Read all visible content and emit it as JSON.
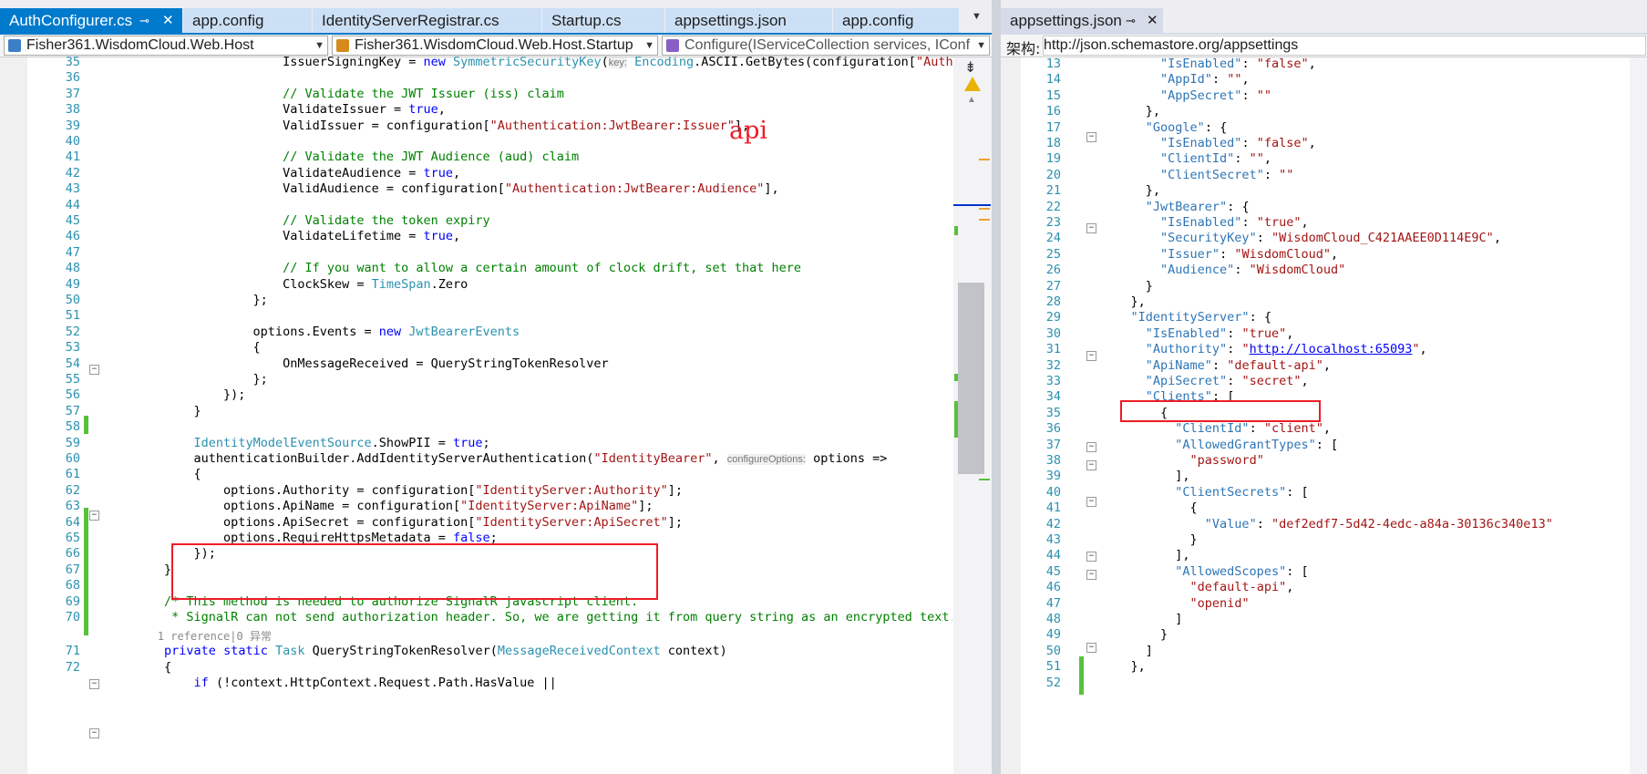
{
  "left_pane": {
    "tabs": [
      {
        "label": "AuthConfigurer.cs",
        "state": "active-pinned"
      },
      {
        "label": "app.config",
        "state": "inactive"
      },
      {
        "label": "IdentityServerRegistrar.cs",
        "state": "inactive"
      },
      {
        "label": "Startup.cs",
        "state": "inactive"
      },
      {
        "label": "appsettings.json",
        "state": "inactive"
      },
      {
        "label": "app.config",
        "state": "inactive"
      }
    ],
    "nav": {
      "project": "Fisher361.WisdomCloud.Web.Host",
      "class": "Fisher361.WisdomCloud.Web.Host.Startup",
      "member": "Configure(IServiceCollection services, IConf"
    },
    "annotation": "api",
    "line_numbers": [
      "35",
      "36",
      "37",
      "38",
      "39",
      "40",
      "41",
      "42",
      "43",
      "44",
      "45",
      "46",
      "47",
      "48",
      "49",
      "50",
      "51",
      "52",
      "53",
      "54",
      "55",
      "56",
      "57",
      "58",
      "59",
      "60",
      "61",
      "62",
      "63",
      "64",
      "65",
      "66",
      "67",
      "68",
      "69",
      "70",
      "71",
      "72"
    ],
    "codelens": "1 reference|0 异常",
    "code_lines": [
      "                        IssuerSigningKey = new SymmetricSecurityKey(key: Encoding.ASCII.GetBytes(configuration[\"Authenticat",
      "",
      "                        // Validate the JWT Issuer (iss) claim",
      "                        ValidateIssuer = true,",
      "                        ValidIssuer = configuration[\"Authentication:JwtBearer:Issuer\"],",
      "",
      "                        // Validate the JWT Audience (aud) claim",
      "                        ValidateAudience = true,",
      "                        ValidAudience = configuration[\"Authentication:JwtBearer:Audience\"],",
      "",
      "                        // Validate the token expiry",
      "                        ValidateLifetime = true,",
      "",
      "                        // If you want to allow a certain amount of clock drift, set that here",
      "                        ClockSkew = TimeSpan.Zero",
      "                    };",
      "",
      "                    options.Events = new JwtBearerEvents",
      "                    {",
      "                        OnMessageReceived = QueryStringTokenResolver",
      "                    };",
      "                });",
      "            }",
      "",
      "            IdentityModelEventSource.ShowPII = true;",
      "            authenticationBuilder.AddIdentityServerAuthentication(\"IdentityBearer\", configureOptions: options =>",
      "            {",
      "                options.Authority = configuration[\"IdentityServer:Authority\"];",
      "                options.ApiName = configuration[\"IdentityServer:ApiName\"];",
      "                options.ApiSecret = configuration[\"IdentityServer:ApiSecret\"];",
      "                options.RequireHttpsMetadata = false;",
      "            });",
      "        }",
      "",
      "        /* This method is needed to authorize SignalR javascript client.",
      "         * SignalR can not send authorization header. So, we are getting it from query string as an encrypted text. */",
      "        private static Task QueryStringTokenResolver(MessageReceivedContext context)",
      "        {",
      "            if (!context.HttpContext.Request.Path.HasValue ||"
    ]
  },
  "right_pane": {
    "tab": {
      "label": "appsettings.json"
    },
    "schema_label": "架构:",
    "schema_url": "http://json.schemastore.org/appsettings",
    "line_numbers": [
      "13",
      "14",
      "15",
      "16",
      "17",
      "18",
      "19",
      "20",
      "21",
      "22",
      "23",
      "24",
      "25",
      "26",
      "27",
      "28",
      "29",
      "30",
      "31",
      "32",
      "33",
      "34",
      "35",
      "36",
      "37",
      "38",
      "39",
      "40",
      "41",
      "42",
      "43",
      "44",
      "45",
      "46",
      "47",
      "48",
      "49",
      "50",
      "51",
      "52"
    ],
    "json_lines": [
      "        \"IsEnabled\": \"false\",",
      "        \"AppId\": \"\",",
      "        \"AppSecret\": \"\"",
      "      },",
      "      \"Google\": {",
      "        \"IsEnabled\": \"false\",",
      "        \"ClientId\": \"\",",
      "        \"ClientSecret\": \"\"",
      "      },",
      "      \"JwtBearer\": {",
      "        \"IsEnabled\": \"true\",",
      "        \"SecurityKey\": \"WisdomCloud_C421AAEE0D114E9C\",",
      "        \"Issuer\": \"WisdomCloud\",",
      "        \"Audience\": \"WisdomCloud\"",
      "      }",
      "    },",
      "    \"IdentityServer\": {",
      "      \"IsEnabled\": \"true\",",
      "      \"Authority\": \"http://localhost:65093\",",
      "      \"ApiName\": \"default-api\",",
      "      \"ApiSecret\": \"secret\",",
      "      \"Clients\": [",
      "        {",
      "          \"ClientId\": \"client\",",
      "          \"AllowedGrantTypes\": [",
      "            \"password\"",
      "          ],",
      "          \"ClientSecrets\": [",
      "            {",
      "              \"Value\": \"def2edf7-5d42-4edc-a84a-30136c340e13\"",
      "            }",
      "          ],",
      "          \"AllowedScopes\": [",
      "            \"default-api\",",
      "            \"openid\"",
      "          ]",
      "        }",
      "      ]",
      "    },",
      ""
    ]
  },
  "colors": {
    "accent": "#007acc",
    "highlight_box": "#ee1c25",
    "modified_bar": "#57c13a"
  }
}
